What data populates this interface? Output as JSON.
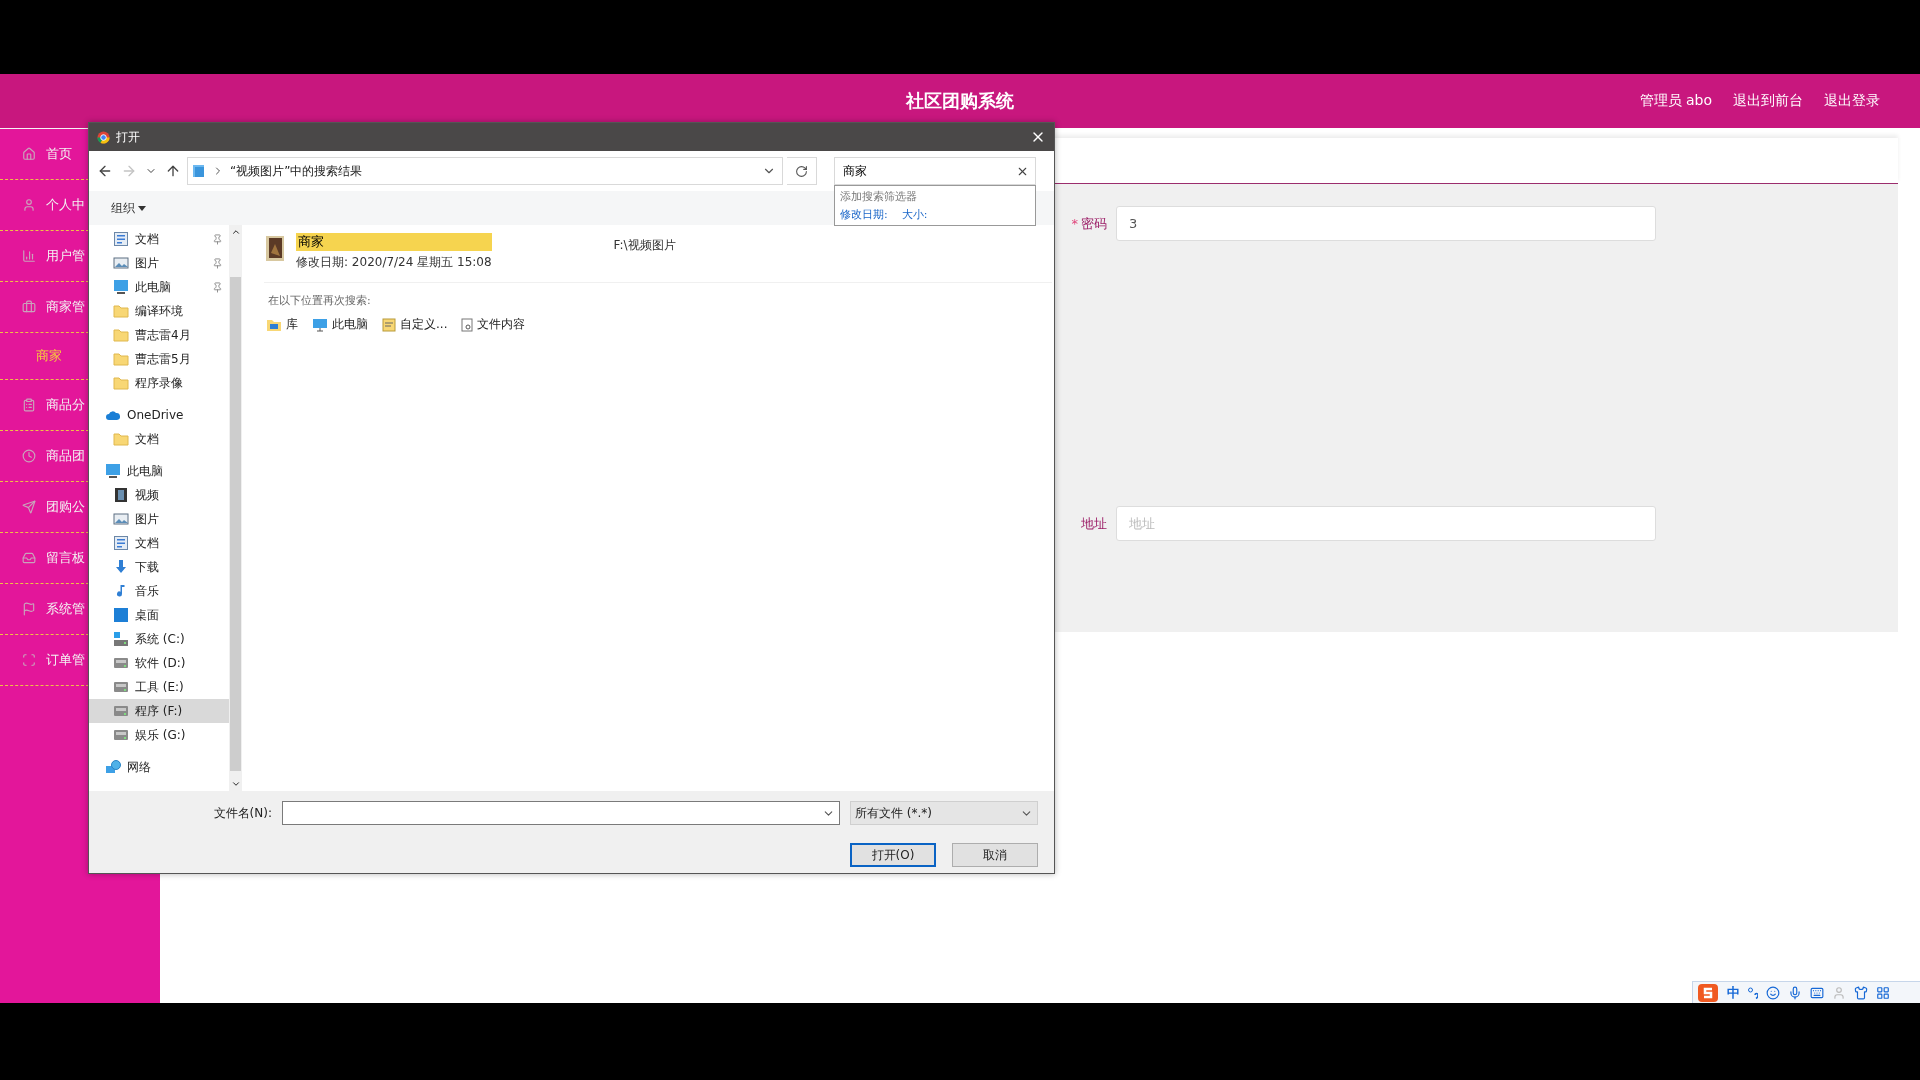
{
  "header": {
    "title": "社区团购系统",
    "user_links": [
      "管理员 abo",
      "退出到前台",
      "退出登录"
    ]
  },
  "sidebar": {
    "items": [
      {
        "label": "首页",
        "kind": "menu",
        "selected": false
      },
      {
        "label": "个人中",
        "kind": "menu",
        "selected": false
      },
      {
        "label": "用户管",
        "kind": "menu",
        "selected": false
      },
      {
        "label": "商家管",
        "kind": "menu",
        "selected": false
      },
      {
        "label": "商家",
        "kind": "submenu",
        "selected": true
      },
      {
        "label": "商品分",
        "kind": "menu",
        "selected": false
      },
      {
        "label": "商品团",
        "kind": "menu",
        "selected": false
      },
      {
        "label": "团购公",
        "kind": "menu",
        "selected": false
      },
      {
        "label": "留言板",
        "kind": "menu",
        "selected": false
      },
      {
        "label": "系统管",
        "kind": "menu",
        "selected": false
      },
      {
        "label": "订单管",
        "kind": "menu",
        "selected": false
      }
    ]
  },
  "form": {
    "fields": [
      {
        "label": "密码",
        "required_mark": "*",
        "value": "3"
      },
      {
        "label": "地址",
        "placeholder": "地址"
      }
    ]
  },
  "dialog": {
    "title": "打开",
    "nav_buttons": [
      {
        "kind": "back",
        "disabled": false
      },
      {
        "kind": "forward",
        "disabled": true
      },
      {
        "kind": "recent",
        "disabled": false
      },
      {
        "kind": "up",
        "disabled": false
      }
    ],
    "address": "“视频图片”中的搜索结果",
    "search": {
      "value": "商家"
    },
    "search_suggestions": {
      "heading": "添加搜索筛选器",
      "filters": [
        "修改日期:",
        "大小:"
      ]
    },
    "toolbar": {
      "organize": "组织"
    },
    "nav_pane": {
      "quick_access": [
        {
          "label": "文档",
          "kind": "doc",
          "pinned": true,
          "selected": false
        },
        {
          "label": "图片",
          "kind": "picture",
          "pinned": true,
          "selected": false
        },
        {
          "label": "此电脑",
          "kind": "pc",
          "pinned": true,
          "selected": false
        },
        {
          "label": "编译环境",
          "kind": "folder",
          "pinned": false,
          "selected": false
        },
        {
          "label": "曹志雷4月",
          "kind": "folder",
          "pinned": false,
          "selected": false
        },
        {
          "label": "曹志雷5月",
          "kind": "folder",
          "pinned": false,
          "selected": false
        },
        {
          "label": "程序录像",
          "kind": "folder",
          "pinned": false,
          "selected": false
        }
      ],
      "tree": [
        {
          "label": "OneDrive",
          "kind": "cloud",
          "selected": false,
          "children": [
            {
              "label": "文档",
              "kind": "folder",
              "selected": false
            }
          ]
        },
        {
          "label": "此电脑",
          "kind": "pc",
          "selected": false,
          "children": [
            {
              "label": "视频",
              "kind": "video",
              "selected": false
            },
            {
              "label": "图片",
              "kind": "picture",
              "selected": false
            },
            {
              "label": "文档",
              "kind": "doc",
              "selected": false
            },
            {
              "label": "下载",
              "kind": "download",
              "selected": false
            },
            {
              "label": "音乐",
              "kind": "music",
              "selected": false
            },
            {
              "label": "桌面",
              "kind": "desktop",
              "selected": false
            },
            {
              "label": "系统 (C:)",
              "kind": "system-drive",
              "selected": false
            },
            {
              "label": "软件 (D:)",
              "kind": "drive",
              "selected": false
            },
            {
              "label": "工具 (E:)",
              "kind": "drive",
              "selected": false
            },
            {
              "label": "程序 (F:)",
              "kind": "drive",
              "selected": true
            },
            {
              "label": "娱乐 (G:)",
              "kind": "drive",
              "selected": false
            }
          ]
        },
        {
          "label": "网络",
          "kind": "network",
          "selected": false
        }
      ]
    },
    "results": [
      {
        "name": "商家",
        "detail": "修改日期: 2020/7/24 星期五 15:08",
        "location": "F:\\视频图片"
      }
    ],
    "search_again": {
      "heading": "在以下位置再次搜索:",
      "locations": [
        {
          "label": "库",
          "kind": "library"
        },
        {
          "label": "此电脑",
          "kind": "pc"
        },
        {
          "label": "自定义...",
          "kind": "custom"
        },
        {
          "label": "文件内容",
          "kind": "content"
        }
      ]
    },
    "footer": {
      "filename_label": "文件名(N):",
      "filetype": "所有文件 (*.*)",
      "buttons": [
        {
          "label": "打开(O)",
          "default": true
        },
        {
          "label": "取消",
          "default": false
        }
      ]
    }
  },
  "ime_bar": {
    "mode": "中"
  }
}
